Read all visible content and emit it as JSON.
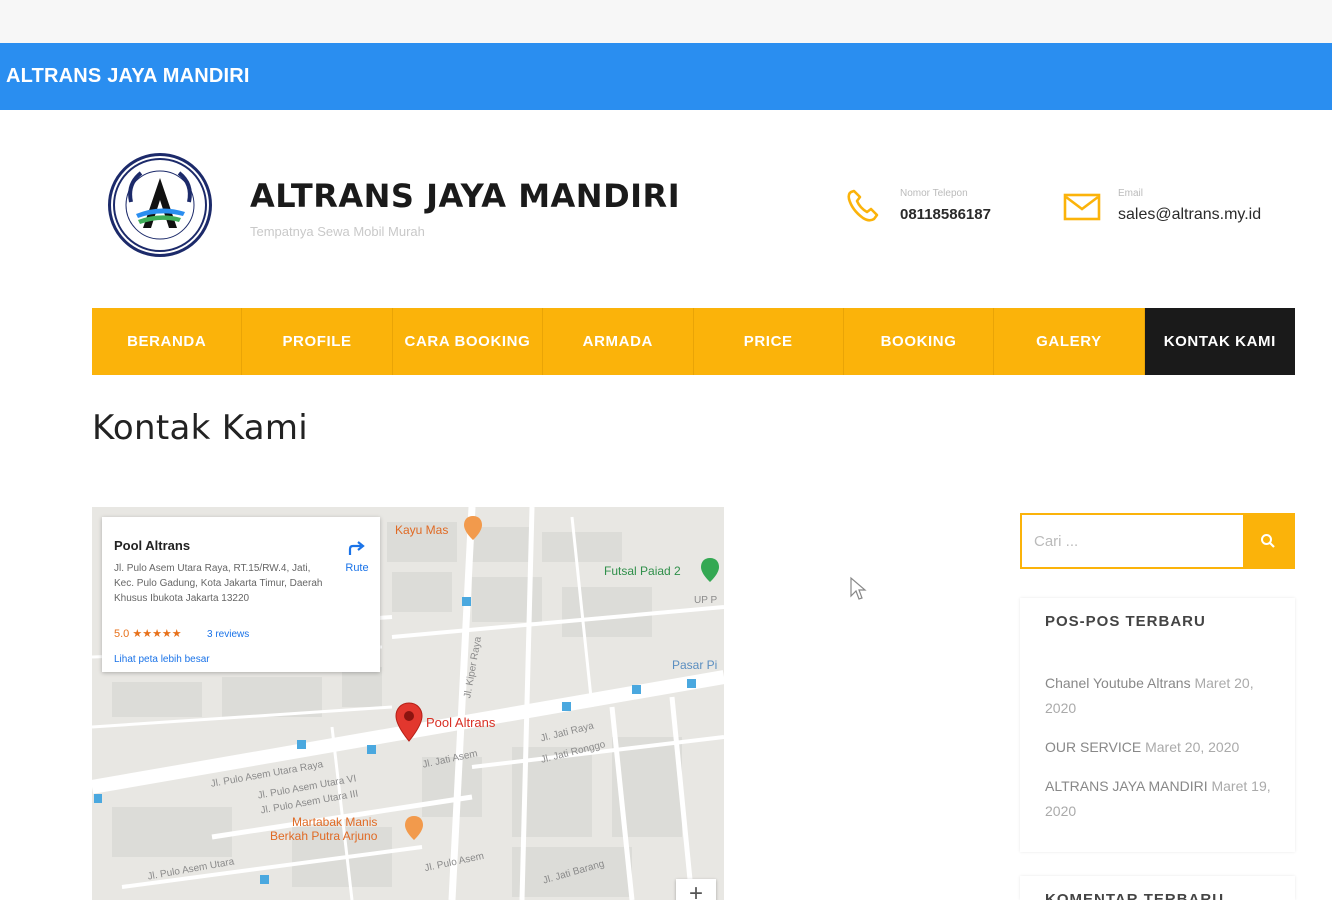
{
  "topbar": {
    "brand": "ALTRANS JAYA MANDIRI"
  },
  "header": {
    "title": "ALTRANS JAYA MANDIRI",
    "tagline": "Tempatnya Sewa Mobil Murah",
    "phone": {
      "label": "Nomor Telepon",
      "value": "08118586187",
      "icon": "phone-icon"
    },
    "email": {
      "label": "Email",
      "value": "sales@altrans.my.id",
      "icon": "mail-icon"
    }
  },
  "nav": {
    "items": [
      {
        "label": "BERANDA"
      },
      {
        "label": "PROFILE"
      },
      {
        "label": "CARA BOOKING"
      },
      {
        "label": "ARMADA"
      },
      {
        "label": "PRICE"
      },
      {
        "label": "BOOKING"
      },
      {
        "label": "GALERY"
      },
      {
        "label": "KONTAK KAMI"
      }
    ],
    "active": "KONTAK KAMI"
  },
  "page": {
    "title": "Kontak Kami"
  },
  "map": {
    "card": {
      "name": "Pool Altrans",
      "address": "Jl. Pulo Asem Utara Raya, RT.15/RW.4, Jati, Kec. Pulo Gadung, Kota Jakarta Timur, Daerah Khusus Ibukota Jakarta 13220",
      "rating": "5.0 ★★★★★",
      "reviews": "3 reviews",
      "larger_map": "Lihat peta lebih besar",
      "directions": "Rute"
    },
    "places": {
      "kayu_mas": "Kayu Mas",
      "futsal": "Futsal Paiad 2",
      "pasar": "Pasar Pi",
      "pool": "Pool Altrans",
      "martabak": "Martabak Manis",
      "berkah": "Berkah Putra Arjuno",
      "up": "UP P"
    },
    "streets": {
      "pulo_asem": "Jl. Pulo Asem Utara Raya",
      "pulo_asem_1": "Jl. Pulo Asem Utara VI",
      "pulo_asem_2": "Jl. Pulo Asem Utara III",
      "pulo_asem_3": "Jl. Pulo Asem Utara",
      "jati_1": "Jl. Jati Asem",
      "jati_2": "Jl. Jati Raya",
      "jati_3": "Jl. Jati Ronggo",
      "jati_4": "Jl. Jati Barang",
      "kiper": "Jl. Kiper Raya",
      "pulo_asem_raya": "Jl. Pulo Asem"
    },
    "zoom_in": "+"
  },
  "sidebar": {
    "search": {
      "placeholder": "Cari ..."
    },
    "recent_posts": {
      "title": "POS-POS TERBARU",
      "items": [
        {
          "title": "Chanel Youtube Altrans",
          "date": "Maret 20, 2020"
        },
        {
          "title": "OUR SERVICE",
          "date": "Maret 20, 2020"
        },
        {
          "title": "ALTRANS JAYA MANDIRI",
          "date": "Maret 19, 2020"
        }
      ]
    },
    "recent_comments": {
      "title": "KOMENTAR TERBARU"
    }
  },
  "colors": {
    "topbar": "#2a8ef0",
    "nav": "#fbb30a",
    "nav_active": "#1a1a1a",
    "accent": "#fbb30a"
  }
}
